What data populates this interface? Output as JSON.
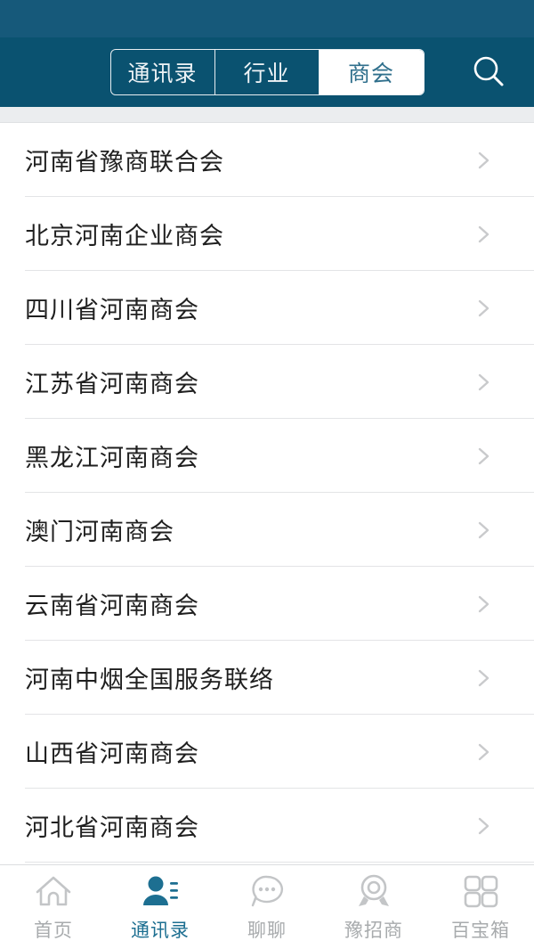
{
  "theme": {
    "statusbar_color": "#16597a",
    "navbar_color": "#0a5270",
    "accent_color": "#1d6f91",
    "active_tab_bg": "#ffffff",
    "active_tab_text": "#2f6f8c",
    "inactive_tab_text": "#a8abad",
    "divider_color": "#e3e4e6",
    "band_color": "#ebedef",
    "chevron_color": "#c9cacc",
    "row_text_color": "#1f1f1f"
  },
  "header": {
    "segments": [
      {
        "label": "通讯录",
        "active": false
      },
      {
        "label": "行业",
        "active": false
      },
      {
        "label": "商会",
        "active": true
      }
    ],
    "search_icon": "search-icon"
  },
  "list": {
    "items": [
      {
        "label": "河南省豫商联合会",
        "chevron": "chevron-right-icon"
      },
      {
        "label": "北京河南企业商会",
        "chevron": "chevron-right-icon"
      },
      {
        "label": "四川省河南商会",
        "chevron": "chevron-right-icon"
      },
      {
        "label": "江苏省河南商会",
        "chevron": "chevron-right-icon"
      },
      {
        "label": "黑龙江河南商会",
        "chevron": "chevron-right-icon"
      },
      {
        "label": "澳门河南商会",
        "chevron": "chevron-right-icon"
      },
      {
        "label": "云南省河南商会",
        "chevron": "chevron-right-icon"
      },
      {
        "label": "河南中烟全国服务联络",
        "chevron": "chevron-right-icon"
      },
      {
        "label": "山西省河南商会",
        "chevron": "chevron-right-icon"
      },
      {
        "label": "河北省河南商会",
        "chevron": "chevron-right-icon"
      }
    ]
  },
  "tabbar": {
    "items": [
      {
        "label": "首页",
        "icon": "home-icon",
        "active": false
      },
      {
        "label": "通讯录",
        "icon": "contacts-icon",
        "active": true
      },
      {
        "label": "聊聊",
        "icon": "chat-icon",
        "active": false
      },
      {
        "label": "豫招商",
        "icon": "medal-icon",
        "active": false
      },
      {
        "label": "百宝箱",
        "icon": "grid-icon",
        "active": false
      }
    ]
  }
}
